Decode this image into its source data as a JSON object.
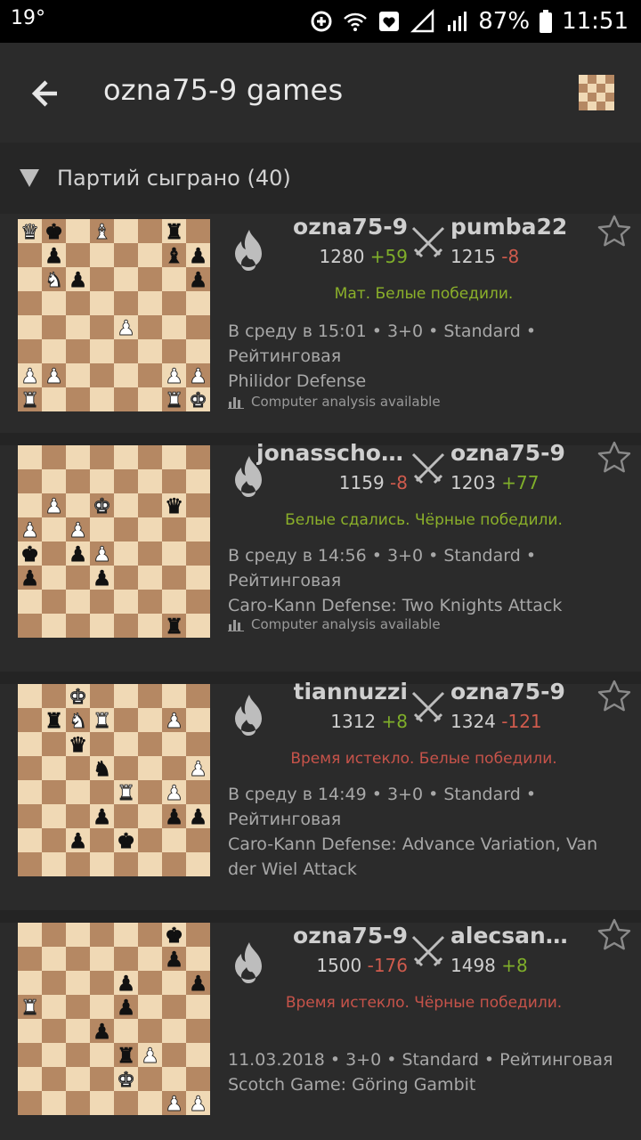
{
  "status_bar": {
    "temperature": "19°",
    "battery": "87%",
    "time": "11:51"
  },
  "toolbar": {
    "title": "ozna75-9 games",
    "back_icon": "arrow-left-icon",
    "board_icon": "chessboard-icon"
  },
  "section": {
    "label": "Партий сыграно (40)"
  },
  "colors": {
    "light_square": "#f0d9b5",
    "dark_square": "#b58863",
    "positive": "#7fae2a",
    "negative": "#d05b4d"
  },
  "games": [
    {
      "white": "ozna75-9",
      "white_rating": "1280",
      "white_diff": "+59",
      "black": "pumba22",
      "black_rating": "1215",
      "black_diff": "-8",
      "result": "Мат. Белые победили.",
      "meta_line1": "В среду в 15:01 • 3+0 • Standard •",
      "meta_line2": "Рейтинговая",
      "opening": "Philidor Defense",
      "analysis": "Computer analysis available",
      "board": [
        "Qk.B..r.",
        ".p....bp",
        ".Np....p",
        "........",
        "....P...",
        "........",
        "PP....PP",
        "R.....RK"
      ]
    },
    {
      "white": "jonasschoenfelder",
      "white_rating": "1159",
      "white_diff": "-8",
      "black": "ozna75-9",
      "black_rating": "1203",
      "black_diff": "+77",
      "result": "Белые сдались. Чёрные победили.",
      "meta_line1": "В среду в 14:56 • 3+0 • Standard •",
      "meta_line2": "Рейтинговая",
      "opening": "Caro-Kann Defense: Two Knights Attack",
      "analysis": "Computer analysis available",
      "board": [
        "........",
        "........",
        ".P.K..q.",
        "P.P.....",
        "k.pP....",
        "p..p....",
        "........",
        "......r."
      ]
    },
    {
      "white": "tiannuzzi",
      "white_rating": "1312",
      "white_diff": "+8",
      "black": "ozna75-9",
      "black_rating": "1324",
      "black_diff": "-121",
      "result": "Время истекло. Белые победили.",
      "meta_line1": "В среду в 14:49 • 3+0 • Standard •",
      "meta_line2": "Рейтинговая",
      "opening": "Caro-Kann Defense: Advance Variation, Van der Wiel Attack",
      "analysis": "",
      "board": [
        "..K.....",
        ".rNR..P.",
        "..q.....",
        "...n...P",
        "....R.P.",
        "...p..pp",
        "..p.k...",
        "........"
      ]
    },
    {
      "white": "ozna75-9",
      "white_rating": "1500",
      "white_diff": "-176",
      "black": "alecsandro",
      "black_rating": "1498",
      "black_diff": "+8",
      "result": "Время истекло. Чёрные победили.",
      "meta_line1": "11.03.2018 • 3+0 • Standard • Рейтинговая",
      "meta_line2": "Scotch Game: Göring Gambit",
      "opening": "",
      "analysis": "",
      "board": [
        "......k.",
        "......p.",
        "....p..p",
        "R...p...",
        "...p....",
        "....rP..",
        "....K...",
        "......PP"
      ]
    }
  ]
}
